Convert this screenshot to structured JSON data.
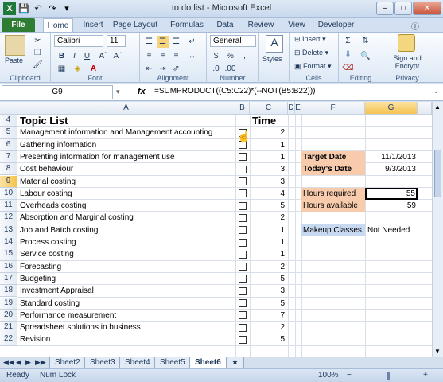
{
  "window": {
    "title": "to do list - Microsoft Excel"
  },
  "tabs": [
    "File",
    "Home",
    "Insert",
    "Page Layout",
    "Formulas",
    "Data",
    "Review",
    "View",
    "Developer"
  ],
  "ribbon": {
    "clipboard": {
      "paste": "Paste",
      "label": "Clipboard"
    },
    "font": {
      "name": "Calibri",
      "size": "11",
      "label": "Font",
      "bold": "B",
      "italic": "I",
      "underline": "U"
    },
    "alignment": {
      "label": "Alignment"
    },
    "number": {
      "format": "General",
      "label": "Number",
      "currency": "$",
      "percent": "%",
      "comma": ","
    },
    "styles": {
      "label": "Styles"
    },
    "cells": {
      "insert": "Insert",
      "delete": "Delete",
      "format": "Format",
      "label": "Cells"
    },
    "editing": {
      "label": "Editing"
    },
    "privacy": {
      "sign": "Sign and",
      "encrypt": "Encrypt",
      "label": "Privacy"
    }
  },
  "formula_bar": {
    "cell": "G9",
    "fx": "fx",
    "formula": "=SUMPRODUCT((C5:C22)*(--NOT(B5:B22)))"
  },
  "columns": [
    "A",
    "B",
    "C",
    "D",
    "E",
    "F",
    "G"
  ],
  "rows": [
    "4",
    "5",
    "6",
    "7",
    "8",
    "9",
    "10",
    "11",
    "12",
    "13",
    "14",
    "15",
    "16",
    "17",
    "18",
    "19",
    "20",
    "21",
    "22"
  ],
  "headers": {
    "topic": "Topic List",
    "time": "Time"
  },
  "topics": [
    {
      "name": "Management information and Management accounting",
      "time": "2"
    },
    {
      "name": "Gathering information",
      "time": "1"
    },
    {
      "name": "Presenting information for management use",
      "time": "1"
    },
    {
      "name": "Cost behaviour",
      "time": "3"
    },
    {
      "name": "Material costing",
      "time": "3"
    },
    {
      "name": "Labour costing",
      "time": "4"
    },
    {
      "name": "Overheads costing",
      "time": "5"
    },
    {
      "name": "Absorption and Marginal costing",
      "time": "2"
    },
    {
      "name": "Job and Batch costing",
      "time": "1"
    },
    {
      "name": "Process costing",
      "time": "1"
    },
    {
      "name": "Service costing",
      "time": "1"
    },
    {
      "name": "Forecasting",
      "time": "2"
    },
    {
      "name": "Budgeting",
      "time": "5"
    },
    {
      "name": "Investment Appraisal",
      "time": "3"
    },
    {
      "name": "Standard costing",
      "time": "5"
    },
    {
      "name": "Performance measurement",
      "time": "7"
    },
    {
      "name": "Spreadsheet solutions in business",
      "time": "2"
    },
    {
      "name": "Revision",
      "time": "5"
    }
  ],
  "side": {
    "target_date_label": "Target Date",
    "target_date": "11/1/2013",
    "today_label": "Today's Date",
    "today": "9/3/2013",
    "hours_required_label": "Hours required",
    "hours_required": "55",
    "hours_available_label": "Hours available",
    "hours_available": "59",
    "makeup_label": "Makeup Classes",
    "makeup": "Not Needed"
  },
  "sheets": [
    "Sheet2",
    "Sheet3",
    "Sheet4",
    "Sheet5",
    "Sheet6"
  ],
  "status": {
    "ready": "Ready",
    "numlock": "Num Lock",
    "zoom": "100%"
  },
  "colors": {
    "orange": "#f8cbad",
    "blue": "#c6d9f0",
    "file_tab": "#2f7d32"
  }
}
